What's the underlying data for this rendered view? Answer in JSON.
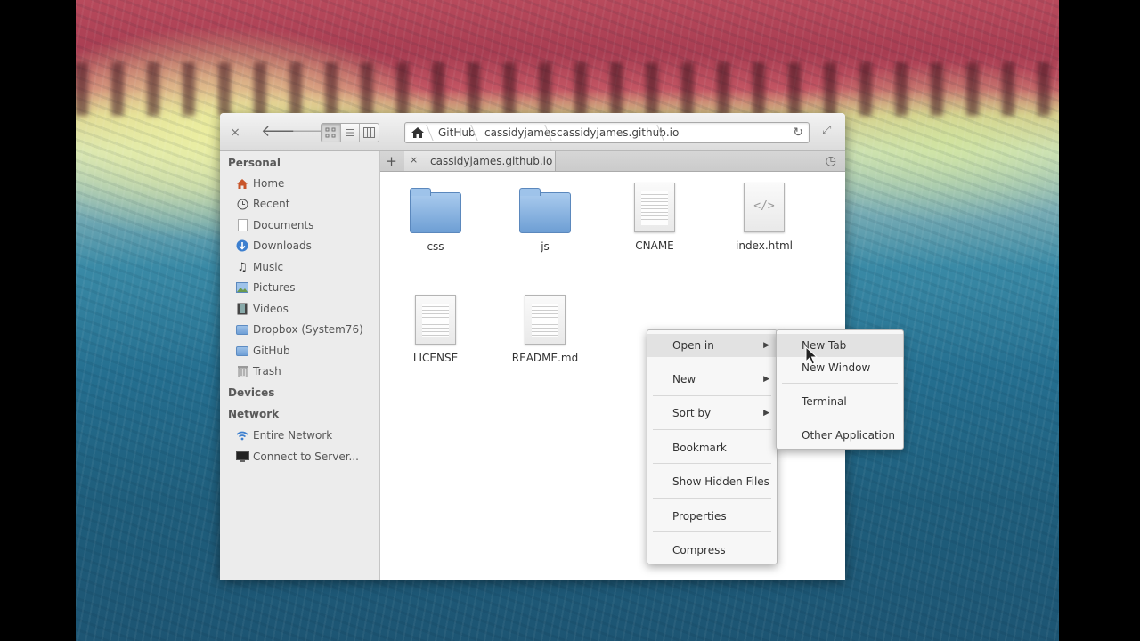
{
  "window": {
    "close": "×",
    "pathbar": {
      "crumbs": [
        "GitHub",
        "cassidyjames",
        "cassidyjames.github.io"
      ]
    }
  },
  "sidebar": {
    "personal_heading": "Personal",
    "personal_items": [
      {
        "label": "Home",
        "icon": "home-icon"
      },
      {
        "label": "Recent",
        "icon": "recent-icon"
      },
      {
        "label": "Documents",
        "icon": "document-icon"
      },
      {
        "label": "Downloads",
        "icon": "download-icon"
      },
      {
        "label": "Music",
        "icon": "music-icon"
      },
      {
        "label": "Pictures",
        "icon": "pictures-icon"
      },
      {
        "label": "Videos",
        "icon": "video-icon"
      },
      {
        "label": "Dropbox (System76)",
        "icon": "folder-icon"
      },
      {
        "label": "GitHub",
        "icon": "folder-icon"
      },
      {
        "label": "Trash",
        "icon": "trash-icon"
      }
    ],
    "devices_heading": "Devices",
    "network_heading": "Network",
    "network_items": [
      {
        "label": "Entire Network",
        "icon": "wifi-icon"
      },
      {
        "label": "Connect to Server...",
        "icon": "monitor-icon"
      }
    ]
  },
  "tabs": {
    "add": "+",
    "items": [
      {
        "label": "cassidyjames.github.io",
        "close": "×"
      }
    ]
  },
  "files": [
    {
      "name": "css",
      "type": "folder"
    },
    {
      "name": "js",
      "type": "folder"
    },
    {
      "name": "CNAME",
      "type": "text"
    },
    {
      "name": "index.html",
      "type": "html"
    },
    {
      "name": "LICENSE",
      "type": "text"
    },
    {
      "name": "README.md",
      "type": "text"
    }
  ],
  "context_menu": {
    "items": [
      "Open in",
      "New",
      "Sort by",
      "Bookmark",
      "Show Hidden Files",
      "Properties",
      "Compress"
    ],
    "highlighted": "Open in"
  },
  "submenu": {
    "items": [
      "New Tab",
      "New Window",
      "Terminal",
      "Other Application"
    ],
    "highlighted": "New Tab"
  }
}
